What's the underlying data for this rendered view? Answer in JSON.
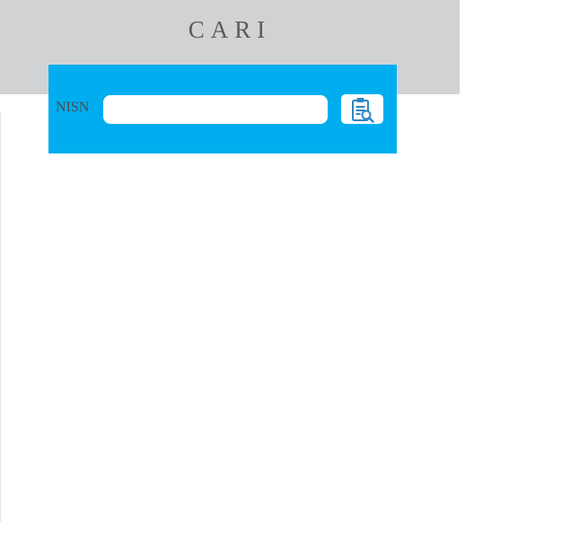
{
  "header": {
    "title": "CARI"
  },
  "search": {
    "field_label": "NISN",
    "input_value": "",
    "placeholder": "",
    "button_icon": "clipboard-search-icon"
  },
  "colors": {
    "header_background": "#d1d2d4",
    "panel_background": "#00aeef",
    "icon_color": "#2f86c4"
  }
}
